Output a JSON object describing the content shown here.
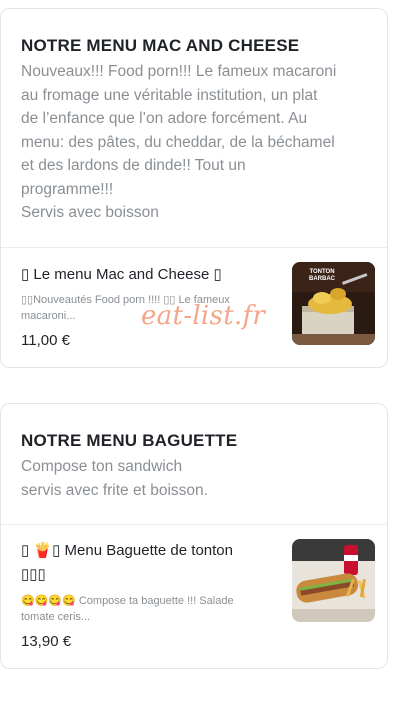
{
  "sections": [
    {
      "title": "NOTRE MENU MAC AND CHEESE",
      "description": "Nouveaux!!! Food porn!!! Le fameux macaroni\nau fromage une véritable institution, un plat\nde l’enfance que l’on adore forcément. Au\nmenu: des pâtes, du cheddar, de la béchamel\net des lardons de dinde!! Tout un\nprogramme!!!\nServis avec boisson",
      "items": [
        {
          "name": "▯ Le menu Mac and Cheese ▯",
          "description": "▯▯Nouveautés Food porn !!!! ▯▯ Le fameux\nmacaroni...",
          "price": "11,00 €",
          "image_text": "TONTON\nBARBAC"
        }
      ]
    },
    {
      "title": "NOTRE MENU BAGUETTE",
      "description": "Compose ton sandwich\nservis avec frite et boisson.",
      "items": [
        {
          "name": "▯ 🍟▯ Menu Baguette de tonton\n▯▯▯",
          "description": "😋😋😋😋 Compose ta baguette !!! Salade\ntomate ceris...",
          "price": "13,90 €"
        }
      ]
    }
  ],
  "watermark": "eat-list.fr"
}
